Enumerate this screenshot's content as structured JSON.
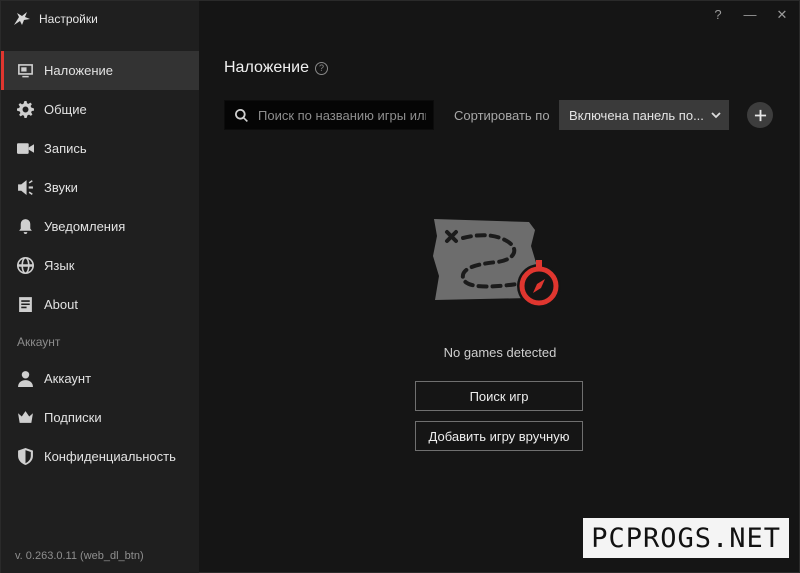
{
  "app": {
    "title": "Настройки",
    "logo_icon": "wolf-logo-icon"
  },
  "window_controls": {
    "help": "?",
    "minimize": "—",
    "close": "✕"
  },
  "sidebar": {
    "items": [
      {
        "label": "Наложение",
        "icon": "overlay-icon",
        "active": true
      },
      {
        "label": "Общие",
        "icon": "gear-icon"
      },
      {
        "label": "Запись",
        "icon": "camera-icon"
      },
      {
        "label": "Звуки",
        "icon": "speaker-icon"
      },
      {
        "label": "Уведомления",
        "icon": "bell-icon"
      },
      {
        "label": "Язык",
        "icon": "globe-icon"
      },
      {
        "label": "About",
        "icon": "info-icon"
      }
    ],
    "account_section": "Аккаунт",
    "account_items": [
      {
        "label": "Аккаунт",
        "icon": "user-icon"
      },
      {
        "label": "Подписки",
        "icon": "crown-icon"
      },
      {
        "label": "Конфиденциальность",
        "icon": "shield-icon"
      }
    ],
    "version": "v. 0.263.0.11 (web_dl_btn)"
  },
  "main": {
    "title": "Наложение",
    "help_glyph": "?",
    "search": {
      "placeholder": "Поиск по названию игры или",
      "value": ""
    },
    "sort": {
      "label": "Сортировать по",
      "selected": "Включена панель по..."
    },
    "empty_state": {
      "illustration": "treasure-map-compass-icon",
      "message": "No games detected",
      "scan_button": "Поиск игр",
      "add_button": "Добавить игру вручную"
    }
  },
  "watermark": "PCPROGS.NET",
  "colors": {
    "accent": "#e0362f",
    "background": "#151515",
    "sidebar": "#1f1f1f",
    "active_item": "#333333"
  }
}
